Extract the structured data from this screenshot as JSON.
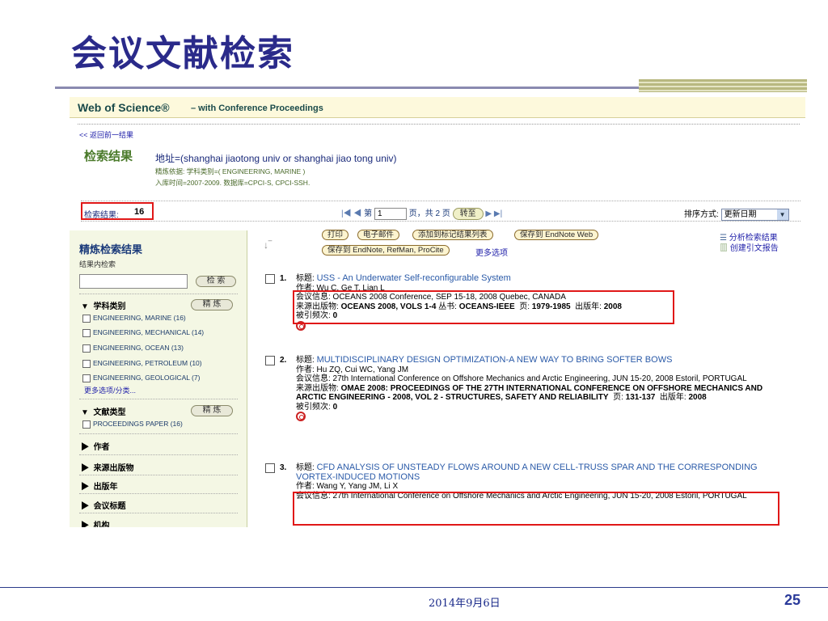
{
  "slide": {
    "title": "会议文献检索",
    "footer_date": "2014年9月6日",
    "page_number": "25"
  },
  "wos": {
    "logo": "Web of Science®",
    "subtitle": "– with Conference Proceedings",
    "back_link": "<< 返回前一结果",
    "results_heading": "检索结果",
    "address_query": "地址=(shanghai jiaotong univ or shanghai jiao tong univ)",
    "refine_line": "精炼依据: 学科类别=( ENGINEERING, MARINE )",
    "time_line": "入库时间=2007-2009. 数据库=CPCI-S, CPCI-SSH.",
    "count_label": "检索结果:",
    "count_value": "16",
    "pager": {
      "prefix": "第",
      "page_value": "1",
      "suffix": "页，共 2 页",
      "go": "转至"
    },
    "sort": {
      "label": "排序方式:",
      "selected": "更新日期"
    }
  },
  "toolbar": {
    "print": "打印",
    "email": "电子邮件",
    "add_marked": "添加到标记结果列表",
    "save_endnote_web": "保存到 EndNote Web",
    "save_to": "保存到 EndNote, RefMan, ProCite",
    "more_options": "更多选项",
    "analyze": "分析检索结果",
    "citation_report": "创建引文报告"
  },
  "sidebar": {
    "title": "精炼检索结果",
    "within_label": "结果内检索",
    "search_btn": "检 索",
    "refine_btn": "精 炼",
    "section_subject": "学科类别",
    "subjects": [
      "ENGINEERING, MARINE (16)",
      "ENGINEERING, MECHANICAL (14)",
      "ENGINEERING, OCEAN (13)",
      "ENGINEERING, PETROLEUM (10)",
      "ENGINEERING, GEOLOGICAL (7)"
    ],
    "more_subjects": "更多选项/分类...",
    "section_doctype": "文献类型",
    "doctypes": [
      "PROCEEDINGS PAPER (16)"
    ],
    "collapsed_sections": [
      "作者",
      "来源出版物",
      "出版年",
      "会议标题",
      "机构"
    ]
  },
  "records": [
    {
      "num": "1.",
      "title_label": "标题:",
      "title": "USS - An Underwater Self-reconfigurable System",
      "authors": "作者: Wu C, Ge T, Lian L",
      "conf": "会议信息: OCEANS 2008 Conference, SEP 15-18, 2008 Quebec, CANADA",
      "source_label": "来源出版物:",
      "source": "OCEANS 2008, VOLS 1-4",
      "series_label": "丛书:",
      "series": "OCEANS-IEEE",
      "pages_label": "页:",
      "pages": "1979-1985",
      "year_label": "出版年:",
      "year": "2008",
      "cited_label": "被引频次:",
      "cited": "0"
    },
    {
      "num": "2.",
      "title_label": "标题:",
      "title": "MULTIDISCIPLINARY DESIGN OPTIMIZATION-A NEW WAY TO BRING SOFTER BOWS",
      "authors": "作者: Hu ZQ, Cui WC, Yang JM",
      "conf": "会议信息: 27th International Conference on Offshore Mechanics and Arctic Engineering, JUN 15-20, 2008 Estoril, PORTUGAL",
      "source_label": "来源出版物:",
      "source": "OMAE 2008: PROCEEDINGS OF THE 27TH INTERNATIONAL CONFERENCE ON OFFSHORE MECHANICS AND ARCTIC ENGINEERING - 2008, VOL 2 - STRUCTURES, SAFETY AND RELIABILITY",
      "pages_label": "页:",
      "pages": "131-137",
      "year_label": "出版年:",
      "year": "2008",
      "cited_label": "被引频次:",
      "cited": "0"
    },
    {
      "num": "3.",
      "title_label": "标题:",
      "title": "CFD ANALYSIS OF UNSTEADY FLOWS AROUND A NEW CELL-TRUSS SPAR AND THE CORRESPONDING VORTEX-INDUCED MOTIONS",
      "authors": "作者: Wang Y, Yang JM, Li X",
      "conf": "会议信息: 27th International Conference on Offshore Mechanics and Arctic Engineering, JUN 15-20, 2008 Estoril, PORTUGAL"
    }
  ],
  "colors": {
    "highlight": "#e01818",
    "title": "#2a2a8a",
    "link": "#2a5aa8"
  }
}
